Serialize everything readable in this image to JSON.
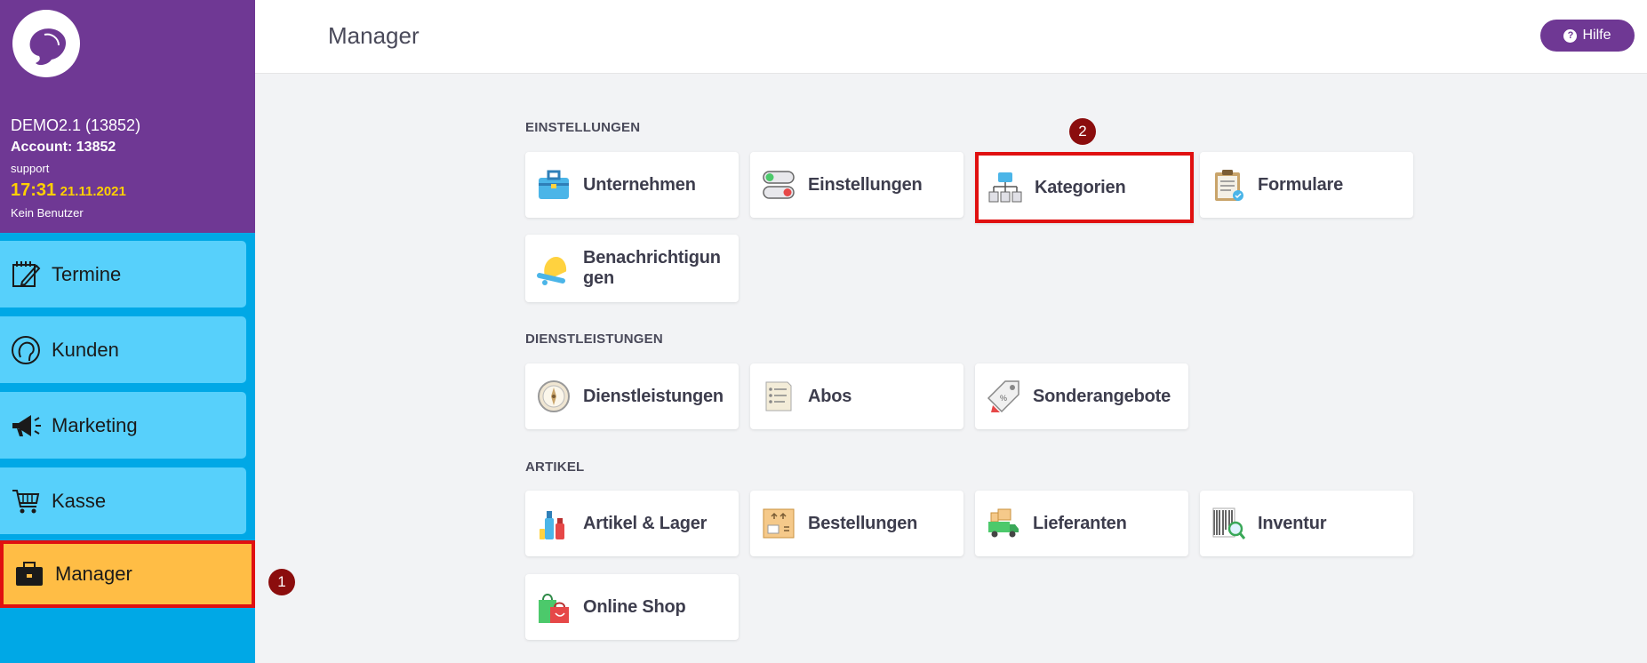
{
  "account": {
    "company": "DEMO2.1 (13852)",
    "account_line": "Account: 13852",
    "user": "support",
    "time": "17:31",
    "date": "21.11.2021",
    "no_user": "Kein Benutzer"
  },
  "sidebar": {
    "items": [
      {
        "label": "Termine",
        "icon": "calendar-edit-icon"
      },
      {
        "label": "Kunden",
        "icon": "customer-head-icon"
      },
      {
        "label": "Marketing",
        "icon": "megaphone-icon"
      },
      {
        "label": "Kasse",
        "icon": "cart-icon"
      },
      {
        "label": "Manager",
        "icon": "briefcase-icon"
      }
    ]
  },
  "header": {
    "title": "Manager",
    "help_label": "Hilfe"
  },
  "sections": {
    "einstellungen": {
      "title": "EINSTELLUNGEN",
      "cards": [
        "Unternehmen",
        "Einstellungen",
        "Kategorien",
        "Formulare",
        "Benachrichtigun gen"
      ]
    },
    "dienstleistungen": {
      "title": "DIENSTLEISTUNGEN",
      "cards": [
        "Dienstleistungen",
        "Abos",
        "Sonderangebote"
      ]
    },
    "artikel": {
      "title": "ARTIKEL",
      "cards": [
        "Artikel & Lager",
        "Bestellungen",
        "Lieferanten",
        "Inventur",
        "Online Shop"
      ]
    }
  },
  "markers": {
    "one": "1",
    "two": "2"
  },
  "colors": {
    "purple": "#6f3894",
    "sidebar_blue": "#00a8e6",
    "nav_light_blue": "#57d0fb",
    "active_orange": "#ffbd45",
    "highlight_red": "#e01010",
    "marker_red": "#8b0d0d"
  }
}
